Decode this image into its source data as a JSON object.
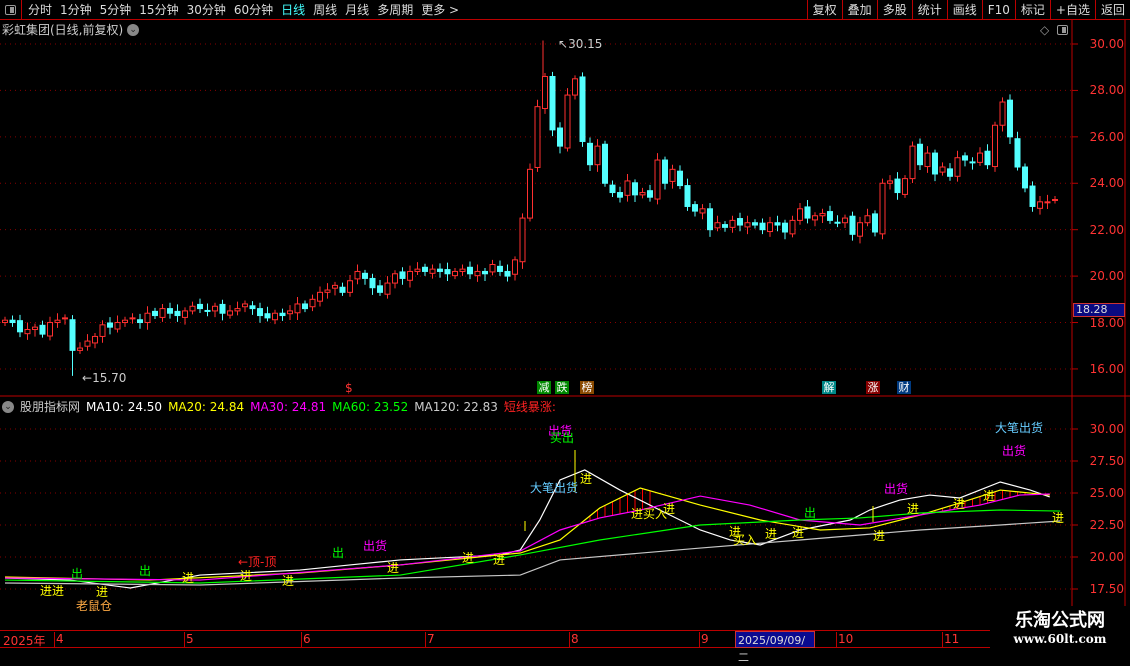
{
  "toolbar": {
    "periods": [
      "分时",
      "1分钟",
      "5分钟",
      "15分钟",
      "30分钟",
      "60分钟",
      "日线",
      "周线",
      "月线",
      "多周期",
      "更多 >"
    ],
    "active": "日线",
    "right_buttons": [
      "复权",
      "叠加",
      "多股",
      "统计",
      "画线",
      "F10",
      "标记",
      "+自选",
      "返回"
    ]
  },
  "main": {
    "title": "彩虹集团(日线,前复权)",
    "high_label": "30.15",
    "low_label": "15.70",
    "current_price": "18.28",
    "y_ticks": [
      "30.00",
      "28.00",
      "26.00",
      "24.00",
      "22.00",
      "20.00",
      "18.00",
      "16.00"
    ],
    "events": [
      "$",
      "减",
      "跌",
      "榜",
      "解",
      "涨",
      "财"
    ]
  },
  "indicator": {
    "name": "股朋指标网",
    "ma10": "MA10: 24.50",
    "ma20": "MA20: 24.84",
    "ma30": "MA30: 24.81",
    "ma60": "MA60: 23.52",
    "ma120": "MA120: 22.83",
    "signal": "短线暴涨:",
    "y_ticks": [
      "30.00",
      "27.50",
      "25.00",
      "22.50",
      "20.00",
      "17.50"
    ],
    "labels": [
      "进进",
      "出",
      "老鼠仓",
      "进",
      "出",
      "进",
      "进",
      "←顶-顶",
      "进",
      "出",
      "出货",
      "进",
      "进",
      "进",
      "出货",
      "买出",
      "大笔出货",
      "进",
      "进",
      "买入",
      "进",
      "出",
      "进",
      "买入",
      "进",
      "进",
      "进",
      "出货",
      "进",
      "进",
      "进",
      "大笔出货",
      "出货",
      "进"
    ]
  },
  "date_axis": {
    "labels": [
      "2025年",
      "4",
      "5",
      "6",
      "7",
      "8",
      "9",
      "10",
      "11"
    ],
    "selected": "2025/09/09/二"
  },
  "watermark": {
    "name": "乐淘公式网",
    "url": "www.60lt.com"
  },
  "colors": {
    "up": "#ff3030",
    "down": "#54ffff",
    "ma10": "#ffffff",
    "ma20": "#ffff00",
    "ma30": "#ff00ff",
    "ma60": "#00ff00",
    "ma120": "#c8c8c8"
  },
  "chart_data": {
    "type": "candlestick",
    "price_range": [
      15.5,
      31
    ],
    "close": [
      18.1,
      18.0,
      17.6,
      17.7,
      17.8,
      17.5,
      18.0,
      18.1,
      18.2,
      16.8,
      16.9,
      17.2,
      17.4,
      17.9,
      17.8,
      18.0,
      18.1,
      18.2,
      18.0,
      18.4,
      18.3,
      18.6,
      18.4,
      18.3,
      18.5,
      18.7,
      18.6,
      18.5,
      18.7,
      18.4,
      18.5,
      18.6,
      18.8,
      18.6,
      18.3,
      18.2,
      18.4,
      18.3,
      18.5,
      18.8,
      18.6,
      19.0,
      19.3,
      19.4,
      19.6,
      19.3,
      19.8,
      20.2,
      19.9,
      19.5,
      19.3,
      19.7,
      20.1,
      19.9,
      20.2,
      20.3,
      20.2,
      20.3,
      20.2,
      20.1,
      20.2,
      20.3,
      20.1,
      20.2,
      20.1,
      20.5,
      20.2,
      20.0,
      20.7,
      22.5,
      24.6,
      27.3,
      28.6,
      26.3,
      25.6,
      27.8,
      28.5,
      25.8,
      24.8,
      25.6,
      24.0,
      23.6,
      23.4,
      24.1,
      23.5,
      23.6,
      23.4,
      25.0,
      24.0,
      24.6,
      23.9,
      23.0,
      22.8,
      22.9,
      22.0,
      22.3,
      22.1,
      22.4,
      22.2,
      22.3,
      22.2,
      22.0,
      22.3,
      22.2,
      21.9,
      22.4,
      22.9,
      22.5,
      22.6,
      22.7,
      22.4,
      22.3,
      22.5,
      21.8,
      22.3,
      22.6,
      21.9,
      24.0,
      24.1,
      23.6,
      24.2,
      25.6,
      24.8,
      25.3,
      24.4,
      24.7,
      24.3,
      25.1,
      25.0,
      24.9,
      25.3,
      24.8,
      26.5,
      27.5,
      26.0,
      24.7,
      23.8,
      23.0,
      23.2,
      23.2,
      23.3
    ],
    "indicator_range": [
      16.5,
      31.5
    ],
    "series": [
      {
        "name": "white",
        "values": [
          [
            0,
            18.36
          ],
          [
            8.7,
            18.2
          ],
          [
            16.7,
            17.58
          ],
          [
            26,
            18.59
          ],
          [
            39.3,
            18.98
          ],
          [
            46,
            19.38
          ],
          [
            52.7,
            19.77
          ],
          [
            66,
            20.16
          ],
          [
            68.7,
            20.55
          ],
          [
            71.3,
            22.89
          ],
          [
            74,
            26.02
          ],
          [
            77.3,
            26.8
          ],
          [
            82,
            25.23
          ],
          [
            87.3,
            23.67
          ],
          [
            92.7,
            22.11
          ],
          [
            96.7,
            21.33
          ],
          [
            100.7,
            20.94
          ],
          [
            106,
            22.11
          ],
          [
            112.7,
            22.89
          ],
          [
            115.3,
            23.67
          ],
          [
            119.3,
            24.45
          ],
          [
            123.3,
            24.84
          ],
          [
            127.3,
            24.61
          ],
          [
            132.7,
            25.86
          ],
          [
            136.7,
            25.23
          ],
          [
            139.3,
            24.69
          ]
        ]
      },
      {
        "name": "yellow",
        "values": [
          [
            0,
            18.44
          ],
          [
            19.3,
            18.2
          ],
          [
            39.3,
            18.75
          ],
          [
            52.7,
            19.38
          ],
          [
            66,
            20.16
          ],
          [
            68.7,
            20.31
          ],
          [
            74,
            21.33
          ],
          [
            79.3,
            23.83
          ],
          [
            84.7,
            25.39
          ],
          [
            92.7,
            24.06
          ],
          [
            100.7,
            22.89
          ],
          [
            108.7,
            22.11
          ],
          [
            115.3,
            22.27
          ],
          [
            122,
            23.28
          ],
          [
            127.3,
            24.22
          ],
          [
            132.7,
            25.23
          ],
          [
            139.3,
            24.84
          ]
        ]
      },
      {
        "name": "magenta",
        "values": [
          [
            0,
            18.36
          ],
          [
            26,
            18.2
          ],
          [
            52.7,
            19.38
          ],
          [
            68.7,
            20.47
          ],
          [
            74,
            22.11
          ],
          [
            79.3,
            23.05
          ],
          [
            84.7,
            23.67
          ],
          [
            92.7,
            24.76
          ],
          [
            99.3,
            24.06
          ],
          [
            106,
            22.89
          ],
          [
            114,
            22.5
          ],
          [
            122,
            23.28
          ],
          [
            130,
            24.06
          ],
          [
            135.3,
            24.84
          ],
          [
            139.3,
            24.92
          ]
        ]
      },
      {
        "name": "green",
        "values": [
          [
            0,
            18.2
          ],
          [
            26,
            17.97
          ],
          [
            52.7,
            18.59
          ],
          [
            68.7,
            20.16
          ],
          [
            79.3,
            21.33
          ],
          [
            92.7,
            22.5
          ],
          [
            106,
            22.89
          ],
          [
            114,
            23.05
          ],
          [
            122,
            23.44
          ],
          [
            132.7,
            23.67
          ],
          [
            140.7,
            23.59
          ]
        ]
      },
      {
        "name": "gray",
        "values": [
          [
            0,
            17.97
          ],
          [
            26,
            17.81
          ],
          [
            52.7,
            18.36
          ],
          [
            68.7,
            18.59
          ],
          [
            74,
            19.77
          ],
          [
            92.7,
            20.7
          ],
          [
            106,
            21.33
          ],
          [
            114,
            21.72
          ],
          [
            122,
            22.11
          ],
          [
            132.7,
            22.5
          ],
          [
            140.7,
            22.81
          ]
        ]
      }
    ]
  }
}
